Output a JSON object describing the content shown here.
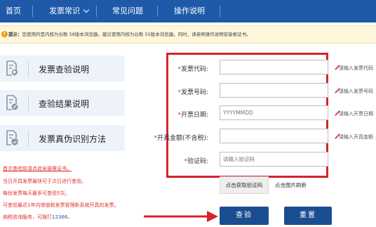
{
  "nav": {
    "items": [
      "首页",
      "发票常识",
      "常见问题",
      "操作说明"
    ]
  },
  "notice": {
    "icon": "!",
    "label": "提示：",
    "text": "您使用的是内核为谷歌 58版本浏览器。建议使用内核为谷歌 55版本浏览器。同时，请参照操作说明安装根证书。"
  },
  "sidebar": {
    "items": [
      {
        "label": "发票查验说明",
        "icon": "magnifier-document-icon"
      },
      {
        "label": "查验结果说明",
        "icon": "pencil-document-icon"
      },
      {
        "label": "发票真伪识别方法",
        "icon": "shield-document-icon"
      }
    ]
  },
  "form": {
    "fields": [
      {
        "required": "*",
        "label": "发票代码:",
        "value": "",
        "placeholder": "",
        "hint": "请输入发票代码"
      },
      {
        "required": "*",
        "label": "发票号码:",
        "value": "",
        "placeholder": "",
        "hint": "请输入发票号码"
      },
      {
        "required": "*",
        "label": "开票日期:",
        "value": "",
        "placeholder": "YYYYMMDD",
        "hint": "请输入开票日期"
      },
      {
        "required": "*",
        "label": "开具金额(不含税):",
        "value": "",
        "placeholder": "",
        "hint": "请输入开具金额"
      },
      {
        "required": "*",
        "label": "验证码:",
        "value": "",
        "placeholder": "请输入验证码",
        "hint": ""
      }
    ],
    "captcha_button": "点击获取验证码",
    "captcha_tip": "点击图片刷新",
    "check_button": "查验",
    "reset_button": "重置"
  },
  "notes": {
    "link": "首次查验前请点此安装根证书。",
    "lines": [
      "当日开具发票最快可于次日进行查验。",
      "每份发票每天最多可查验5次。",
      "可查验最近1年内增值税发票管理新系统开具的发票。"
    ],
    "hotline_prefix": "纳税咨询服务，可拨打",
    "hotline": "12366",
    "hotline_suffix": "。"
  },
  "colors": {
    "nav_bg": "#1e5aa8",
    "highlight": "#d6232b",
    "button": "#1b4e91",
    "notice_bg": "#fff7dc"
  }
}
